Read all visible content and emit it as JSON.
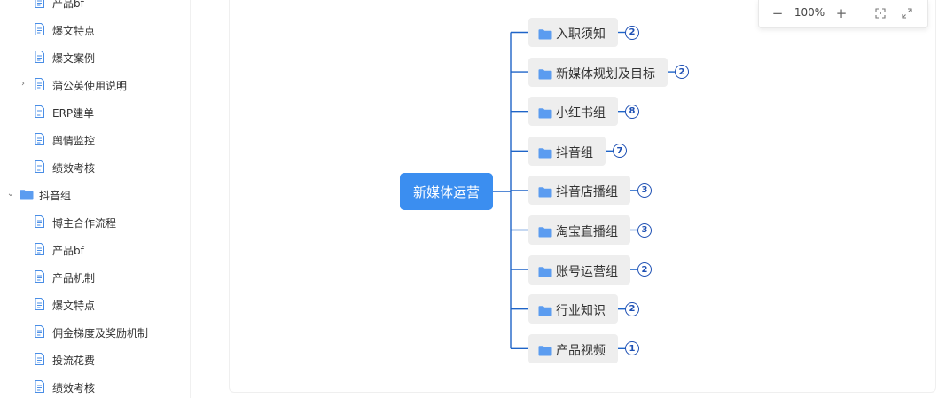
{
  "sidebar": {
    "items": [
      {
        "label": "产品bf",
        "type": "doc"
      },
      {
        "label": "爆文特点",
        "type": "doc"
      },
      {
        "label": "爆文案例",
        "type": "doc"
      },
      {
        "label": "蒲公英使用说明",
        "type": "doc",
        "expand": "›"
      },
      {
        "label": "ERP建单",
        "type": "doc"
      },
      {
        "label": "舆情监控",
        "type": "doc"
      },
      {
        "label": "绩效考核",
        "type": "doc"
      },
      {
        "label": "抖音组",
        "type": "folder",
        "expand": "⌄"
      },
      {
        "label": "博主合作流程",
        "type": "doc"
      },
      {
        "label": "产品bf",
        "type": "doc"
      },
      {
        "label": "产品机制",
        "type": "doc"
      },
      {
        "label": "爆文特点",
        "type": "doc"
      },
      {
        "label": "佣金梯度及奖励机制",
        "type": "doc"
      },
      {
        "label": "投流花费",
        "type": "doc"
      },
      {
        "label": "绩效考核",
        "type": "doc"
      }
    ]
  },
  "toolbar": {
    "zoom_out": "−",
    "zoom_level": "100%",
    "zoom_in": "+",
    "fit_icon": "fit-screen-icon",
    "fullscreen_icon": "fullscreen-icon"
  },
  "mindmap": {
    "root": "新媒体运营",
    "children": [
      {
        "label": "入职须知",
        "count": "2"
      },
      {
        "label": "新媒体规划及目标",
        "count": "2"
      },
      {
        "label": "小红书组",
        "count": "8"
      },
      {
        "label": "抖音组",
        "count": "7"
      },
      {
        "label": "抖音店播组",
        "count": "3"
      },
      {
        "label": "淘宝直播组",
        "count": "3"
      },
      {
        "label": "账号运营组",
        "count": "2"
      },
      {
        "label": "行业知识",
        "count": "2"
      },
      {
        "label": "产品视频",
        "count": "1"
      }
    ]
  },
  "colors": {
    "root_bg": "#3b8ef0",
    "folder": "#5b9cf0",
    "badge": "#1e50b4",
    "node_bg": "#eeeeee"
  }
}
